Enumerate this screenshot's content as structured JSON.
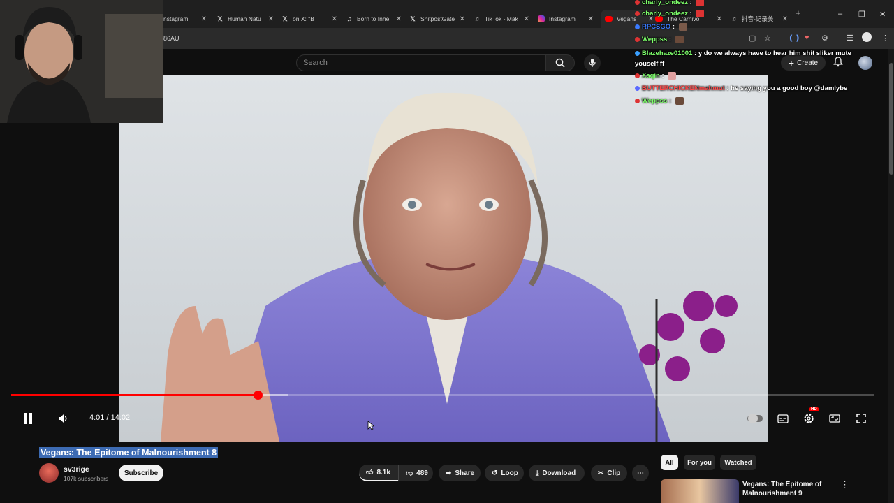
{
  "browser": {
    "tabs": [
      {
        "label": "nstagram",
        "icon": "none"
      },
      {
        "label": "Human Natu",
        "icon": "x-icon"
      },
      {
        "label": "on X: \"B",
        "icon": "x-icon"
      },
      {
        "label": "Born to Inhe",
        "icon": "tiktok-icon"
      },
      {
        "label": "ShitpostGate",
        "icon": "x-icon"
      },
      {
        "label": "TikTok - Mak",
        "icon": "tiktok-icon"
      },
      {
        "label": "Instagram",
        "icon": "instagram-icon"
      },
      {
        "label": "Vegans",
        "icon": "youtube-icon",
        "active": true
      },
      {
        "label": "The Carnivo",
        "icon": "youtube-icon"
      },
      {
        "label": "抖音-记录美",
        "icon": "tiktok-icon"
      }
    ],
    "url_fragment": "86AU",
    "new_tab": "+"
  },
  "youtube": {
    "search_placeholder": "Search",
    "create_label": "Create"
  },
  "player": {
    "time_current": "4:01",
    "time_total": "14:02",
    "time_display": "4:01 / 14:02",
    "progress_fraction": 0.2856,
    "buffer_fraction": 0.32,
    "hd_badge": "HD"
  },
  "chat": [
    {
      "user": "charly_ondeez",
      "color": "#7dff6a",
      "message": "",
      "emote_color": "#d33",
      "badge": "#d33"
    },
    {
      "user": "charly_ondeez",
      "color": "#7dff6a",
      "message": "",
      "emote_color": "#d33",
      "badge": "#d33"
    },
    {
      "user": "RPCSGO",
      "color": "#3a7bff",
      "message": "",
      "emote_color": "#7a5a4a",
      "badge": "#3a7bff"
    },
    {
      "user": "Weppss",
      "color": "#7dff6a",
      "message": "",
      "emote_color": "#6a4a3a",
      "badge": "#d33"
    },
    {
      "user": "Blazehaze01001",
      "color": "#7dff6a",
      "message": "y do we always have to hear him shit sliker mute youself ff",
      "badge": "#3aa0ff"
    },
    {
      "user": "Xaqin",
      "color": "#7dff6a",
      "message": "",
      "emote_color": "#e0a0a0",
      "badge": "#d33"
    },
    {
      "user": "BUTTERCHICKENmahmut",
      "color": "#ff4a4a",
      "message": "he saying you a good boy @damlybe",
      "badge": "#5a6aff"
    },
    {
      "user": "Weppss",
      "color": "#7dff6a",
      "message": "",
      "emote_color": "#6a4a3a",
      "badge": "#d33"
    }
  ],
  "video_info": {
    "title": "Vegans: The Epitome of Malnourishment 8",
    "channel": "sv3rige",
    "subscribers": "107k subscribers",
    "subscribe_label": "Subscribe",
    "likes": "8.1k",
    "dislikes": "489",
    "share_label": "Share",
    "loop_label": "Loop",
    "download_label": "Download",
    "clip_label": "Clip"
  },
  "sidebar": {
    "chips": [
      {
        "label": "All",
        "selected": true
      },
      {
        "label": "For you",
        "selected": false
      },
      {
        "label": "Watched",
        "selected": false
      }
    ],
    "recommendation_title": "Vegans: The Epitome of Malnourishment 9"
  },
  "colors": {
    "progress": "#ff0000",
    "background": "#0f0f0f",
    "title_highlight": "#3d6bb3"
  }
}
